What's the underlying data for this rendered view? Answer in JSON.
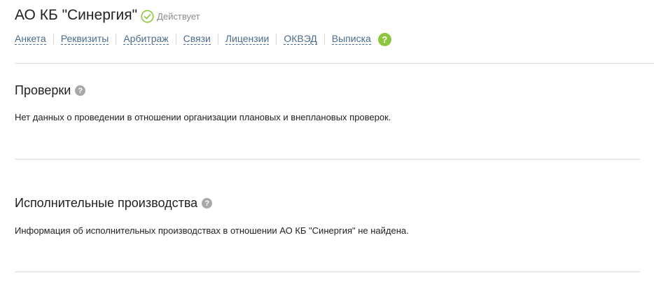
{
  "company": {
    "name": "АО КБ \"Синергия\"",
    "status": "Действует"
  },
  "tabs": [
    {
      "label": "Анкета"
    },
    {
      "label": "Реквизиты"
    },
    {
      "label": "Арбитраж"
    },
    {
      "label": "Связи"
    },
    {
      "label": "Лицензии"
    },
    {
      "label": "ОКВЭД"
    },
    {
      "label": "Выписка"
    }
  ],
  "tabs_help": "?",
  "sections": [
    {
      "title": "Проверки",
      "help": "?",
      "text": "Нет данных о проведении в отношении организации плановых и внеплановых проверок."
    },
    {
      "title": "Исполнительные производства",
      "help": "?",
      "text": "Информация об исполнительных производствах в отношении АО КБ \"Синергия\" не найдена."
    }
  ],
  "colors": {
    "link": "#4a6b8a",
    "status_green": "#8cc63f",
    "help_gray": "#a7a7a7"
  },
  "icons": {
    "status": "check-circle-icon",
    "help": "question-circle-icon"
  }
}
